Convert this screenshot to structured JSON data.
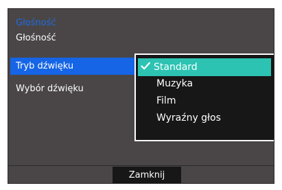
{
  "menu": {
    "section_title": "Głośność",
    "items": [
      {
        "label": "Głośność"
      },
      {
        "label": "Tryb dźwięku"
      },
      {
        "label": "Wybór dźwięku"
      }
    ],
    "selected_index": 1
  },
  "submenu": {
    "options": [
      {
        "label": "Standard"
      },
      {
        "label": "Muzyka"
      },
      {
        "label": "Film"
      },
      {
        "label": "Wyraźny głos"
      }
    ],
    "selected_index": 0,
    "check_icon": "check-icon"
  },
  "footer": {
    "close_label": "Zamknij"
  },
  "colors": {
    "panel_bg": "#4a4647",
    "menu_highlight": "#1565e6",
    "section_title": "#1e6be0",
    "option_highlight": "#2cc3b3",
    "submenu_bg": "#171717",
    "submenu_border": "#ffffff",
    "text": "#ffffff"
  }
}
